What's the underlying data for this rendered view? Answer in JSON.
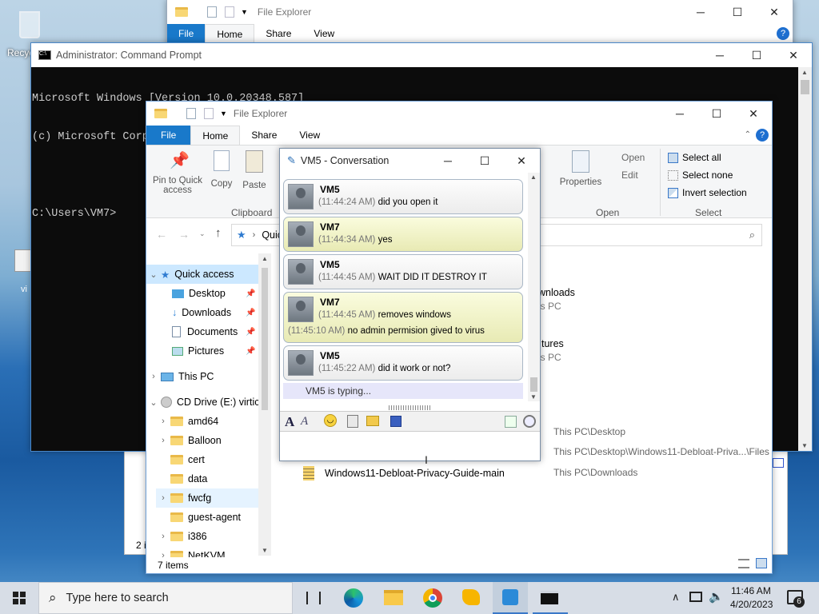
{
  "desktop": {
    "recycle_label": "Recyc",
    "vi_label": "vi"
  },
  "explorer_back": {
    "title": "File Explorer",
    "tabs": [
      "File",
      "Home",
      "Share",
      "View"
    ],
    "left_status": "2 i"
  },
  "cmd": {
    "title": "Administrator: Command Prompt",
    "lines": [
      "Microsoft Windows [Version 10.0.20348.587]",
      "(c) Microsoft Corporation. All rights reserved.",
      "",
      "C:\\Users\\VM7>"
    ]
  },
  "explorer": {
    "title": "File Explorer",
    "tabs": [
      "File",
      "Home",
      "Share",
      "View"
    ],
    "ribbon": {
      "pin": "Pin to Quick access",
      "copy": "Copy",
      "paste": "Paste",
      "clipboard": "Clipboard",
      "properties": "Properties",
      "open": "Open",
      "edit": "Edit",
      "open_group": "Open",
      "select_all": "Select all",
      "select_none": "Select none",
      "invert": "Invert selection",
      "select_group": "Select"
    },
    "address": "Quic",
    "nav": {
      "quick_access": "Quick access",
      "desktop": "Desktop",
      "downloads": "Downloads",
      "documents": "Documents",
      "pictures": "Pictures",
      "this_pc": "This PC",
      "cd_drive": "CD Drive (E:) virtic",
      "folders": [
        "amd64",
        "Balloon",
        "cert",
        "data",
        "fwcfg",
        "guest-agent",
        "i386",
        "NetKVM"
      ]
    },
    "content": {
      "tile1": "wnloads",
      "tile1_sub": "is PC",
      "tile2": "tures",
      "tile2_sub": "is PC",
      "rows": [
        {
          "name": "",
          "path": "This PC\\Desktop"
        },
        {
          "name": "",
          "path": "This PC\\Desktop\\Windows11-Debloat-Priva...\\Files"
        },
        {
          "name": "Windows11-Debloat-Privacy-Guide-main",
          "path": "This PC\\Downloads"
        }
      ]
    },
    "status": "7 items"
  },
  "chat": {
    "title": "VM5 - Conversation",
    "messages": [
      {
        "from": "VM5",
        "lines": [
          {
            "time": "(11:44:24 AM)",
            "text": "did you open it"
          }
        ]
      },
      {
        "from": "VM7",
        "lines": [
          {
            "time": "(11:44:34 AM)",
            "text": "yes"
          }
        ]
      },
      {
        "from": "VM5",
        "lines": [
          {
            "time": "(11:44:45 AM)",
            "text": "WAIT DID IT DESTROY IT"
          }
        ]
      },
      {
        "from": "VM7",
        "lines": [
          {
            "time": "(11:44:45 AM)",
            "text": "removes windows"
          },
          {
            "time": "(11:45:10 AM)",
            "text": "no admin permision gived to virus"
          }
        ]
      },
      {
        "from": "VM5",
        "lines": [
          {
            "time": "(11:45:22 AM)",
            "text": "did it work or not?"
          }
        ]
      }
    ],
    "typing": "VM5 is typing..."
  },
  "taskbar": {
    "search_placeholder": "Type here to search",
    "time": "11:46 AM",
    "date": "4/20/2023",
    "notifications": "6"
  }
}
